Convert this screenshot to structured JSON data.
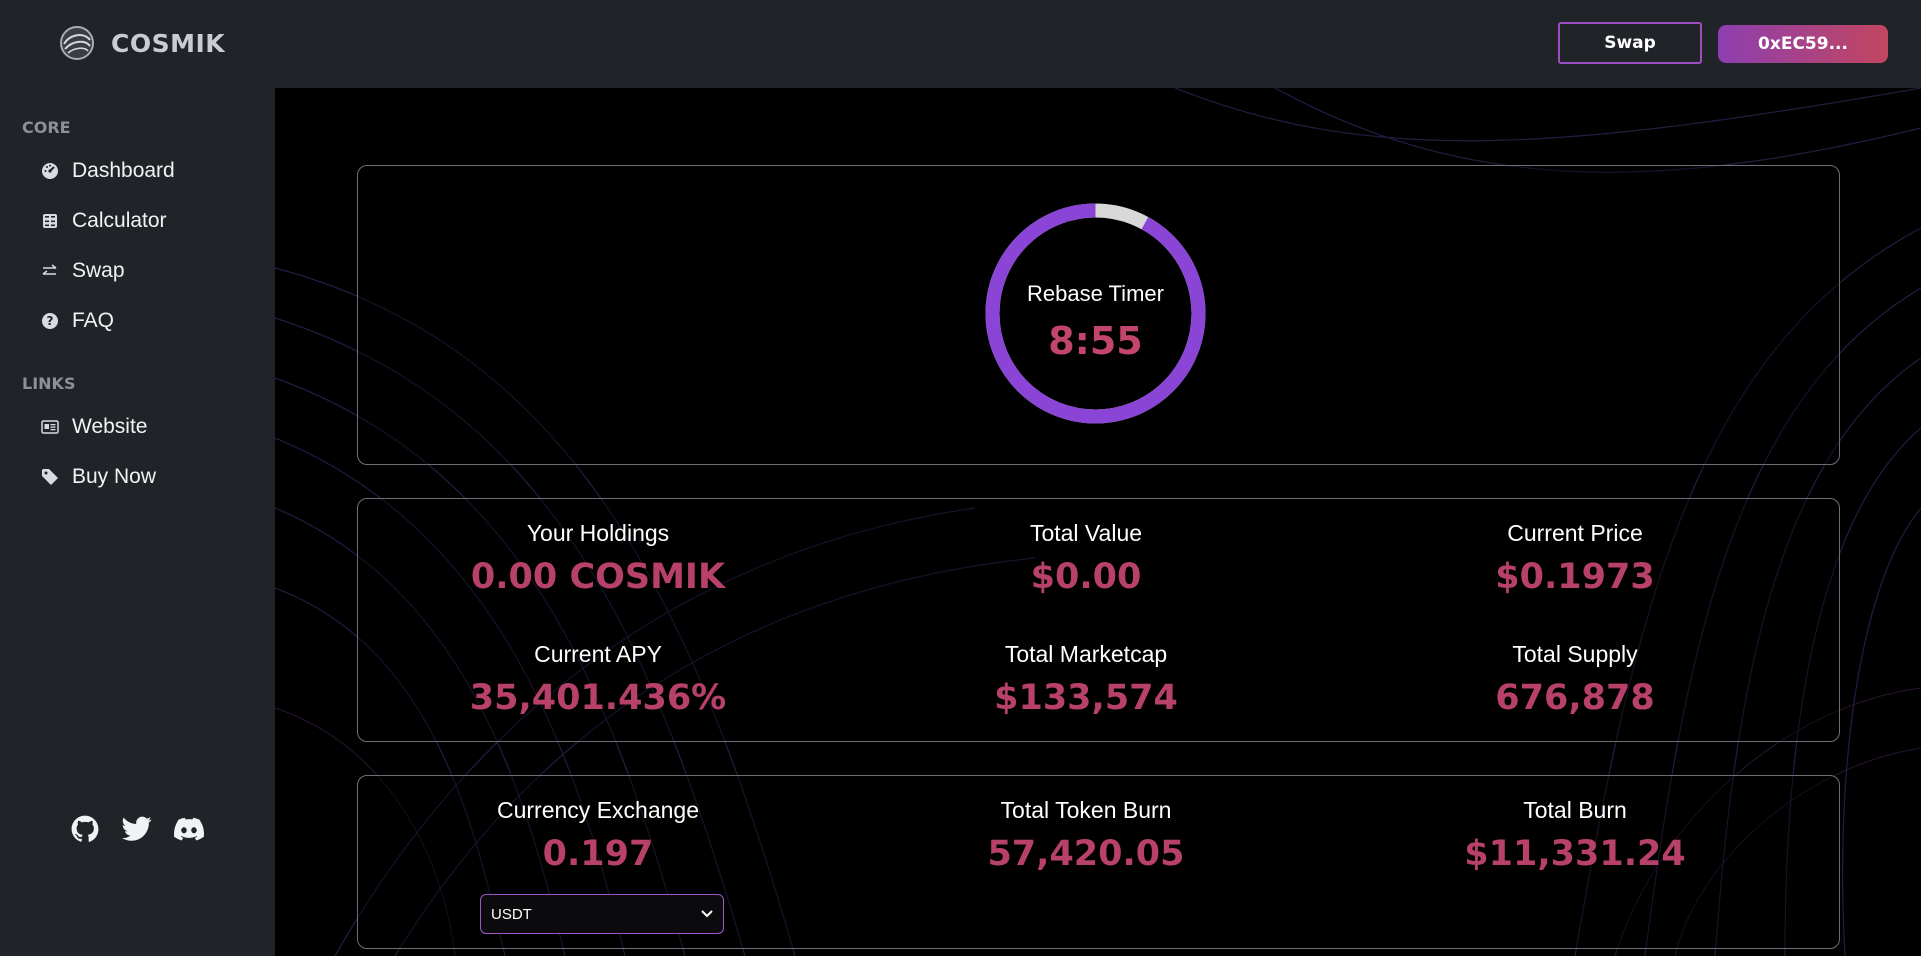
{
  "header": {
    "brand_name": "COSMIK",
    "swap_button": "Swap",
    "wallet_button": "0xEC59..."
  },
  "sidebar": {
    "core_title": "CORE",
    "core_items": [
      {
        "label": "Dashboard",
        "icon": "dashboard-gauge-icon"
      },
      {
        "label": "Calculator",
        "icon": "calculator-icon"
      },
      {
        "label": "Swap",
        "icon": "swap-arrows-icon"
      },
      {
        "label": "FAQ",
        "icon": "question-circle-icon"
      }
    ],
    "links_title": "LINKS",
    "link_items": [
      {
        "label": "Website",
        "icon": "newspaper-icon"
      },
      {
        "label": "Buy Now",
        "icon": "tag-icon"
      }
    ],
    "social": [
      "github-icon",
      "twitter-icon",
      "discord-icon"
    ]
  },
  "timer": {
    "title": "Rebase Timer",
    "value": "8:55",
    "progress": 0.92
  },
  "stats": {
    "holdings_label": "Your Holdings",
    "holdings_value": "0.00 COSMIK",
    "total_value_label": "Total Value",
    "total_value_value": "$0.00",
    "price_label": "Current Price",
    "price_value": "$0.1973",
    "apy_label": "Current APY",
    "apy_value": "35,401.436%",
    "marketcap_label": "Total Marketcap",
    "marketcap_value": "$133,574",
    "supply_label": "Total Supply",
    "supply_value": "676,878"
  },
  "burn": {
    "exchange_label": "Currency Exchange",
    "exchange_value": "0.197",
    "currency_selected": "USDT",
    "token_burn_label": "Total Token Burn",
    "token_burn_value": "57,420.05",
    "total_burn_label": "Total Burn",
    "total_burn_value": "$11,331.24"
  },
  "colors": {
    "accent_purple": "#8a44d6",
    "value_pink": "#b8416a",
    "panel_bg": "#202328"
  }
}
